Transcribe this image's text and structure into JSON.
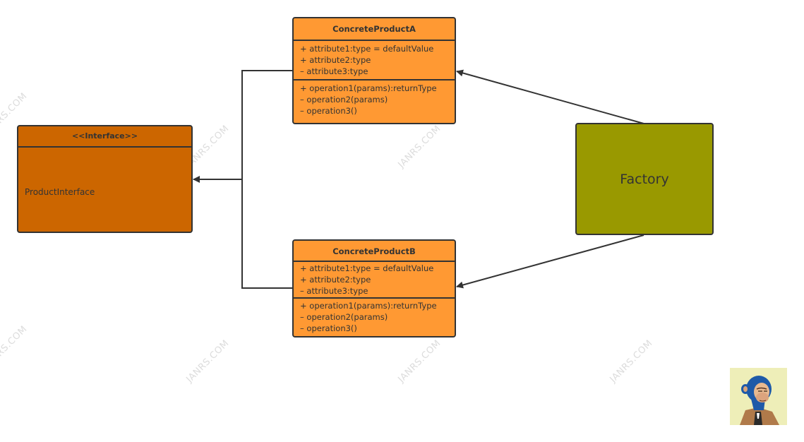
{
  "diagram": {
    "type": "UML class diagram - Factory pattern",
    "colors": {
      "concrete_fill": "#ff9933",
      "interface_fill": "#cc6600",
      "factory_fill": "#999900",
      "stroke": "#333333",
      "watermark": "#dcdcdc"
    },
    "interface": {
      "stereotype": "<<Interface>>",
      "name": "ProductInterface"
    },
    "factory": {
      "label": "Factory"
    },
    "classes": [
      {
        "name": "ConcreteProductA",
        "attributes": [
          "+ attribute1:type = defaultValue",
          "+ attribute2:type",
          "– attribute3:type"
        ],
        "operations": [
          "+ operation1(params):returnType",
          "– operation2(params)",
          "– operation3()"
        ]
      },
      {
        "name": "ConcreteProductB",
        "attributes": [
          "+ attribute1:type = defaultValue",
          "+ attribute2:type",
          "– attribute3:type"
        ],
        "operations": [
          "+ operation1(params):returnType",
          "– operation2(params)",
          "– operation3()"
        ]
      }
    ],
    "connections": [
      {
        "from": "ConcreteProductA",
        "to": "ProductInterface",
        "style": "orthogonal",
        "arrow": "filled-triangle"
      },
      {
        "from": "ConcreteProductB",
        "to": "ProductInterface",
        "style": "orthogonal",
        "arrow": "filled-triangle"
      },
      {
        "from": "Factory",
        "to": "ConcreteProductA",
        "style": "straight",
        "arrow": "filled-triangle"
      },
      {
        "from": "Factory",
        "to": "ConcreteProductB",
        "style": "straight",
        "arrow": "filled-triangle"
      }
    ],
    "watermark_text": "JANRS.COM",
    "avatar": {
      "description": "cartoon ape avatar with blue fur and brown jacket"
    }
  }
}
